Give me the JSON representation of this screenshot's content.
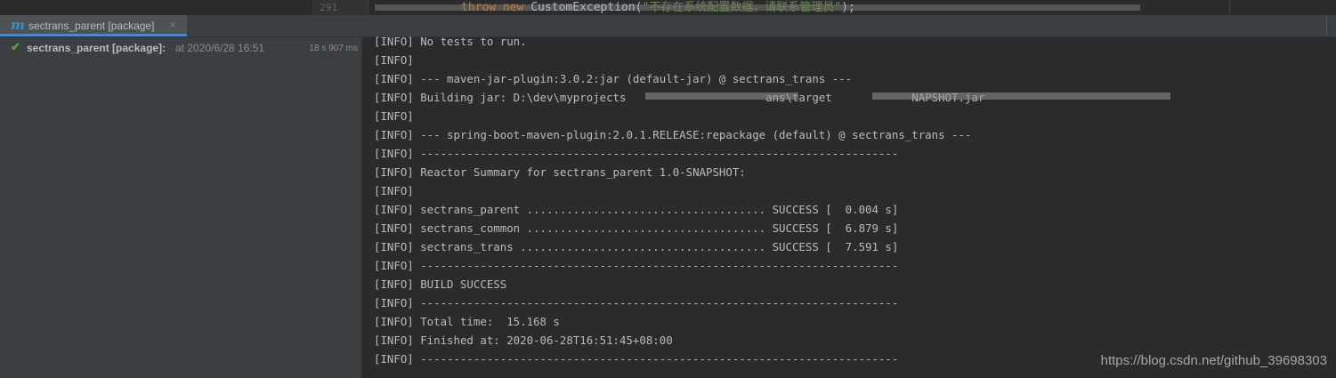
{
  "editor": {
    "line_number": "291",
    "code_keyword1": "throw",
    "code_keyword2": "new",
    "code_call": " CustomException(",
    "code_string": "\"不存在系统配置数据，请联系管理员\"",
    "code_end": ");"
  },
  "run_tab": {
    "icon": "maven-icon",
    "label": "sectrans_parent [package]",
    "close_glyph": "×"
  },
  "tree": {
    "status_icon": "check-icon",
    "name": "sectrans_parent [package]:",
    "time": " at 2020/6/28 16:51",
    "duration": "18 s 907 ms"
  },
  "console": {
    "lines": [
      "[INFO] No tests to run.",
      "[INFO]",
      "[INFO] --- maven-jar-plugin:3.0.2:jar (default-jar) @ sectrans_trans ---",
      "[INFO] Building jar: D:\\dev\\myprojects                     ans\\target            NAPSHOT.jar",
      "[INFO]",
      "[INFO] --- spring-boot-maven-plugin:2.0.1.RELEASE:repackage (default) @ sectrans_trans ---",
      "[INFO] ------------------------------------------------------------------------",
      "[INFO] Reactor Summary for sectrans_parent 1.0-SNAPSHOT:",
      "[INFO]",
      "[INFO] sectrans_parent .................................... SUCCESS [  0.004 s]",
      "[INFO] sectrans_common .................................... SUCCESS [  6.879 s]",
      "[INFO] sectrans_trans ..................................... SUCCESS [  7.591 s]",
      "[INFO] ------------------------------------------------------------------------",
      "[INFO] BUILD SUCCESS",
      "[INFO] ------------------------------------------------------------------------",
      "[INFO] Total time:  15.168 s",
      "[INFO] Finished at: 2020-06-28T16:51:45+08:00",
      "[INFO] ------------------------------------------------------------------------"
    ]
  },
  "watermark": "https://blog.csdn.net/github_39698303"
}
